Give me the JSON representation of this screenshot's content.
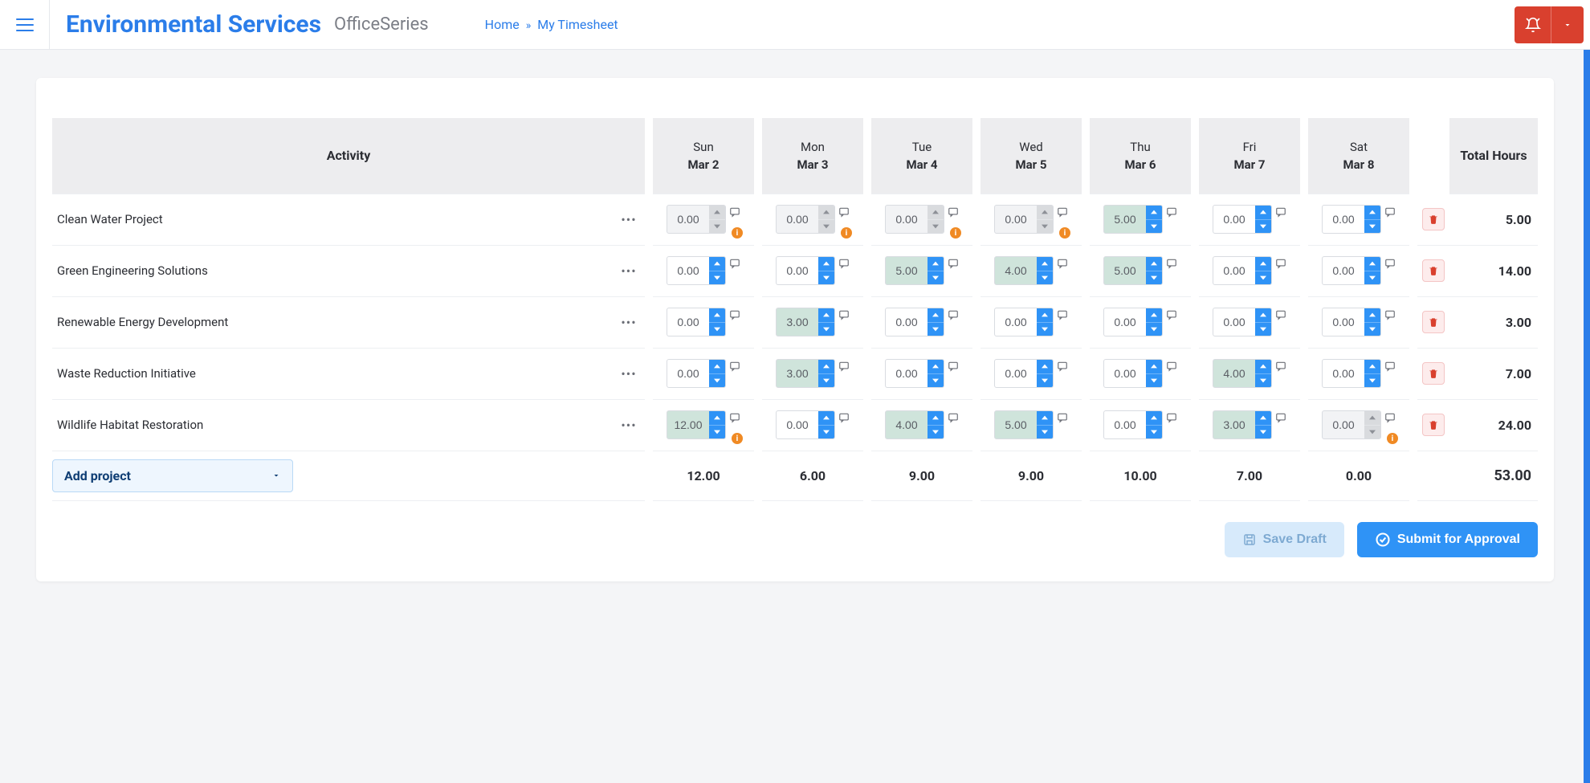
{
  "header": {
    "brand": "Environmental Services",
    "subtitle": "OfficeSeries",
    "home_label": "Home",
    "sep": "»",
    "page_label": "My Timesheet"
  },
  "table": {
    "activity_header": "Activity",
    "total_header": "Total Hours",
    "days": [
      {
        "dow": "Sun",
        "date": "Mar 2"
      },
      {
        "dow": "Mon",
        "date": "Mar 3"
      },
      {
        "dow": "Tue",
        "date": "Mar 4"
      },
      {
        "dow": "Wed",
        "date": "Mar 5"
      },
      {
        "dow": "Thu",
        "date": "Mar 6"
      },
      {
        "dow": "Fri",
        "date": "Mar 7"
      },
      {
        "dow": "Sat",
        "date": "Mar 8"
      }
    ],
    "rows": [
      {
        "activity": "Clean Water Project",
        "cells": [
          {
            "v": "0.00",
            "filled": false,
            "disabled": true,
            "warn": true
          },
          {
            "v": "0.00",
            "filled": false,
            "disabled": true,
            "warn": true
          },
          {
            "v": "0.00",
            "filled": false,
            "disabled": true,
            "warn": true
          },
          {
            "v": "0.00",
            "filled": false,
            "disabled": true,
            "warn": true
          },
          {
            "v": "5.00",
            "filled": true,
            "disabled": false,
            "warn": false
          },
          {
            "v": "0.00",
            "filled": false,
            "disabled": false,
            "warn": false
          },
          {
            "v": "0.00",
            "filled": false,
            "disabled": false,
            "warn": false
          }
        ],
        "total": "5.00"
      },
      {
        "activity": "Green Engineering Solutions",
        "cells": [
          {
            "v": "0.00",
            "filled": false,
            "disabled": false,
            "warn": false
          },
          {
            "v": "0.00",
            "filled": false,
            "disabled": false,
            "warn": false
          },
          {
            "v": "5.00",
            "filled": true,
            "disabled": false,
            "warn": false
          },
          {
            "v": "4.00",
            "filled": true,
            "disabled": false,
            "warn": false
          },
          {
            "v": "5.00",
            "filled": true,
            "disabled": false,
            "warn": false
          },
          {
            "v": "0.00",
            "filled": false,
            "disabled": false,
            "warn": false
          },
          {
            "v": "0.00",
            "filled": false,
            "disabled": false,
            "warn": false
          }
        ],
        "total": "14.00"
      },
      {
        "activity": "Renewable Energy Development",
        "cells": [
          {
            "v": "0.00",
            "filled": false,
            "disabled": false,
            "warn": false
          },
          {
            "v": "3.00",
            "filled": true,
            "disabled": false,
            "warn": false
          },
          {
            "v": "0.00",
            "filled": false,
            "disabled": false,
            "warn": false
          },
          {
            "v": "0.00",
            "filled": false,
            "disabled": false,
            "warn": false
          },
          {
            "v": "0.00",
            "filled": false,
            "disabled": false,
            "warn": false
          },
          {
            "v": "0.00",
            "filled": false,
            "disabled": false,
            "warn": false
          },
          {
            "v": "0.00",
            "filled": false,
            "disabled": false,
            "warn": false
          }
        ],
        "total": "3.00"
      },
      {
        "activity": "Waste Reduction Initiative",
        "cells": [
          {
            "v": "0.00",
            "filled": false,
            "disabled": false,
            "warn": false
          },
          {
            "v": "3.00",
            "filled": true,
            "disabled": false,
            "warn": false
          },
          {
            "v": "0.00",
            "filled": false,
            "disabled": false,
            "warn": false
          },
          {
            "v": "0.00",
            "filled": false,
            "disabled": false,
            "warn": false
          },
          {
            "v": "0.00",
            "filled": false,
            "disabled": false,
            "warn": false
          },
          {
            "v": "4.00",
            "filled": true,
            "disabled": false,
            "warn": false
          },
          {
            "v": "0.00",
            "filled": false,
            "disabled": false,
            "warn": false
          }
        ],
        "total": "7.00"
      },
      {
        "activity": "Wildlife Habitat Restoration",
        "cells": [
          {
            "v": "12.00",
            "filled": true,
            "disabled": false,
            "warn": true
          },
          {
            "v": "0.00",
            "filled": false,
            "disabled": false,
            "warn": false
          },
          {
            "v": "4.00",
            "filled": true,
            "disabled": false,
            "warn": false
          },
          {
            "v": "5.00",
            "filled": true,
            "disabled": false,
            "warn": false
          },
          {
            "v": "0.00",
            "filled": false,
            "disabled": false,
            "warn": false
          },
          {
            "v": "3.00",
            "filled": true,
            "disabled": false,
            "warn": false
          },
          {
            "v": "0.00",
            "filled": false,
            "disabled": true,
            "warn": true
          }
        ],
        "total": "24.00"
      }
    ],
    "day_totals": [
      "12.00",
      "6.00",
      "9.00",
      "9.00",
      "10.00",
      "7.00",
      "0.00"
    ],
    "grand_total": "53.00",
    "add_project_label": "Add project"
  },
  "buttons": {
    "save_draft": "Save Draft",
    "submit": "Submit for Approval"
  }
}
